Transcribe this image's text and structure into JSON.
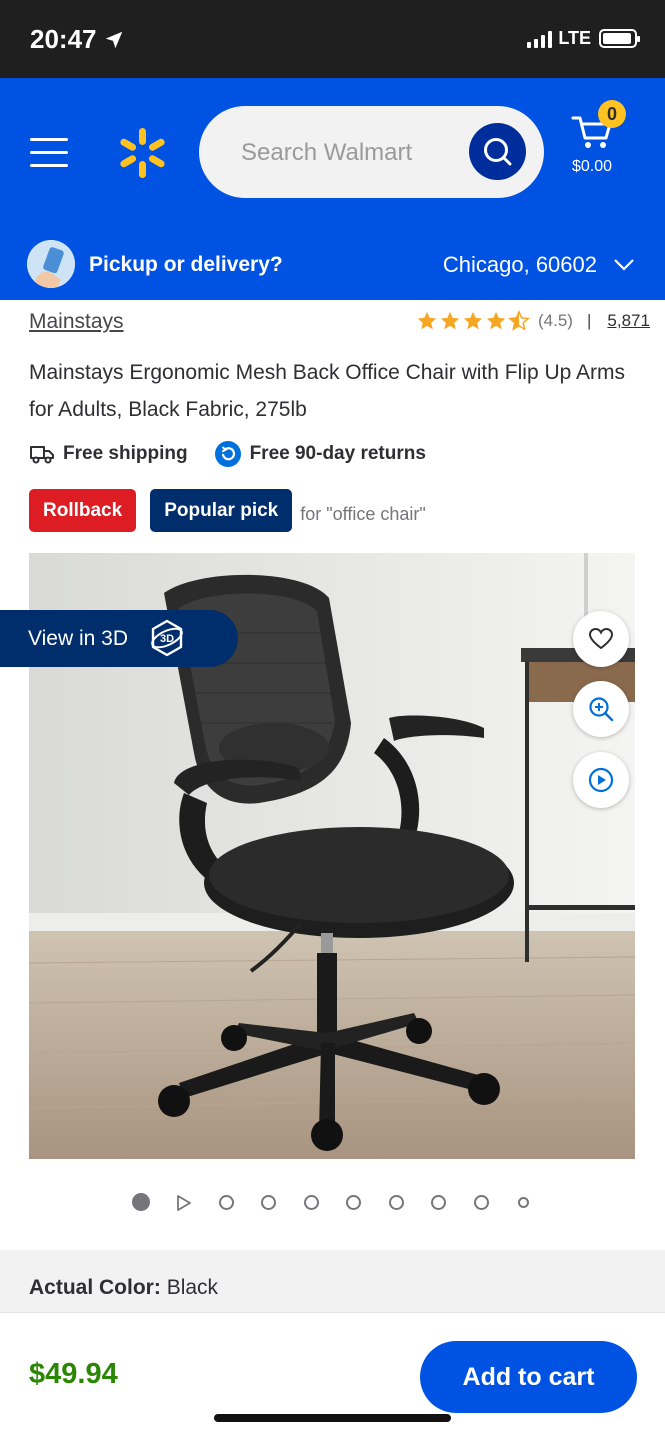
{
  "status_bar": {
    "time": "20:47",
    "network": "LTE"
  },
  "header": {
    "search_placeholder": "Search Walmart",
    "cart_count": "0",
    "cart_total": "$0.00",
    "accent_color": "#0053e2",
    "logo_color": "#ffc220"
  },
  "pickup": {
    "label": "Pickup or delivery?",
    "location": "Chicago, 60602"
  },
  "product": {
    "brand": "Mainstays",
    "rating": "(4.5)",
    "rating_value": 4.5,
    "separator": "|",
    "review_count": "5,871",
    "title": "Mainstays Ergonomic Mesh Back Office Chair with Flip Up Arms for Adults, Black Fabric, 275lb",
    "perks": [
      "Free shipping",
      "Free 90-day returns"
    ],
    "badges": {
      "rollback": "Rollback",
      "popular": "Popular pick",
      "popular_note": "for \"office chair\""
    },
    "view_3d": "View in 3D",
    "image_count_note": "10",
    "color_label": "Actual Color:",
    "color_value": "Black",
    "price": "$49.94",
    "add_to_cart": "Add to cart"
  },
  "icons": [
    "location-arrow-icon",
    "walmart-spark-icon",
    "search-icon",
    "cart-icon",
    "truck-icon",
    "returns-icon",
    "heart-icon",
    "zoom-icon",
    "play-icon",
    "3d-icon",
    "chevron-down-icon"
  ]
}
